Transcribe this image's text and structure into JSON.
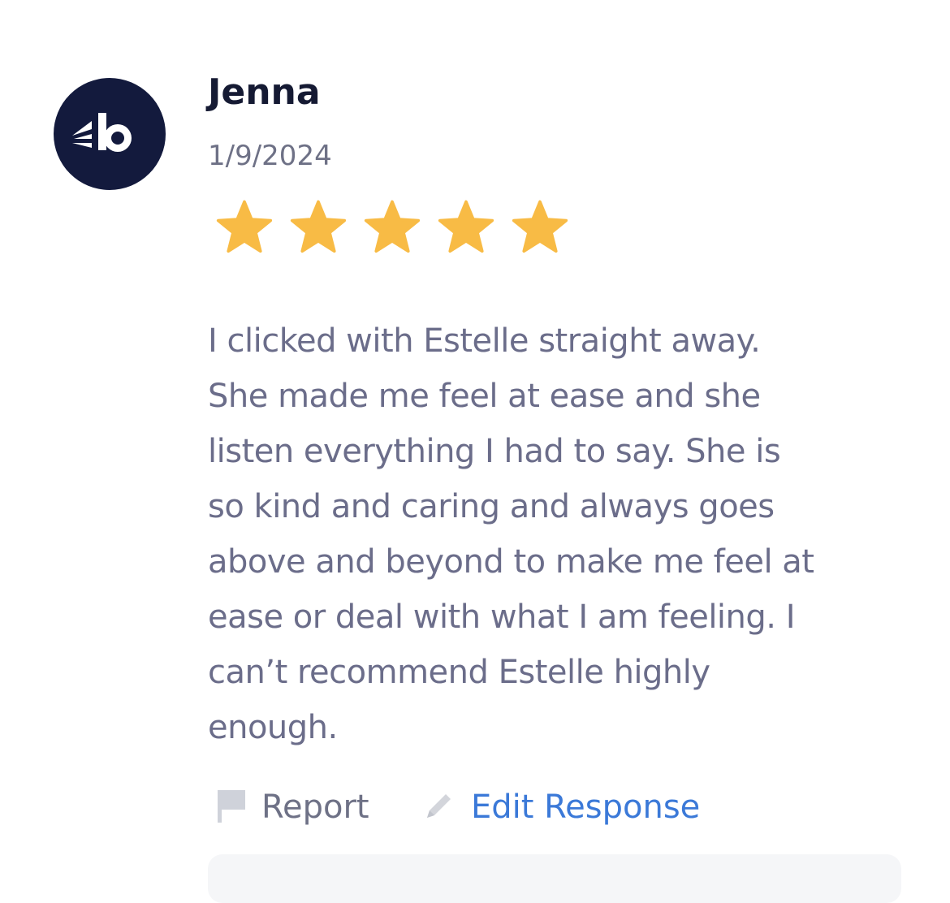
{
  "review": {
    "author": "Jenna",
    "date": "1/9/2024",
    "rating": 5,
    "rating_max": 5,
    "body_lines": [
      "I clicked with Estelle straight away.",
      "She made me feel at ease and she",
      "listen everything I had to say. She is",
      "so kind and caring and always goes",
      "above and beyond to make me feel at",
      "ease or deal with what I am feeling. I",
      "can’t recommend Estelle highly",
      "enough."
    ]
  },
  "actions": {
    "report_label": "Report",
    "report_icon": "flag-icon",
    "edit_label": "Edit Response",
    "edit_icon": "pencil-icon"
  },
  "colors": {
    "avatar_bg": "#131a3d",
    "star": "#f8bb45",
    "link": "#3b79d8",
    "muted_text": "#6b6d8a"
  }
}
